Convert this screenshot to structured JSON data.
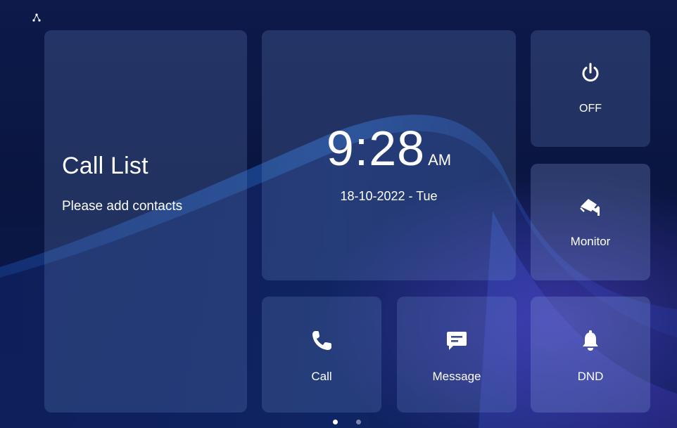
{
  "call_list": {
    "title": "Call List",
    "subtitle": "Please add contacts"
  },
  "clock": {
    "time": "9:28",
    "ampm": "AM",
    "date": "18-10-2022 - Tue"
  },
  "buttons": {
    "off": {
      "label": "OFF",
      "icon": "power-icon"
    },
    "monitor": {
      "label": "Monitor",
      "icon": "security-camera-icon"
    },
    "call": {
      "label": "Call",
      "icon": "phone-icon"
    },
    "message": {
      "label": "Message",
      "icon": "message-icon"
    },
    "dnd": {
      "label": "DND",
      "icon": "bell-icon"
    }
  },
  "pager": {
    "pages": 2,
    "active_page": 1
  },
  "status_bar": {
    "icon": "network-icon"
  },
  "colors": {
    "background": "#0b1540",
    "text": "#ffffff"
  }
}
